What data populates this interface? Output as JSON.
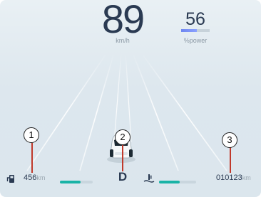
{
  "speed": {
    "value": "89",
    "unit": "km/h"
  },
  "power": {
    "value": "56",
    "unit": "%power",
    "level": 0.56
  },
  "callouts": [
    "1",
    "2",
    "3"
  ],
  "range": {
    "value": "456",
    "unit": "km",
    "level": 0.62
  },
  "gear": "D",
  "temperature": {
    "level": 0.55
  },
  "odometer": {
    "value": "010123",
    "unit": "km"
  },
  "colors": {
    "bar_fill": "#19b3a6",
    "text": "#2a3a52",
    "callout_line": "#c0392b",
    "power_bar": "#7b91f5"
  },
  "icons": {
    "range": "fuel-pump-icon",
    "temperature": "coolant-temperature-icon",
    "vehicle": "car-icon"
  }
}
